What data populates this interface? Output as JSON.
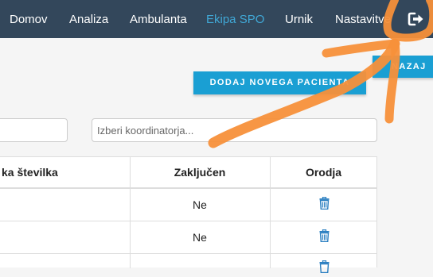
{
  "nav": {
    "items": [
      "Domov",
      "Analiza",
      "Ambulanta",
      "Ekipa SPO",
      "Urnik",
      "Nastavitve"
    ],
    "active_index": 3,
    "logout_icon": "sign-out-icon"
  },
  "actions": {
    "add_patient_label": "DODAJ NOVEGA PACIENTA",
    "back_label": "NAZAJ"
  },
  "filters": {
    "search_value": "",
    "coordinator_placeholder": "Izberi koordinatorja..."
  },
  "table": {
    "columns": [
      "ka številka",
      "Zaključen",
      "Orodja"
    ],
    "rows": [
      {
        "number": "",
        "closed": "Ne",
        "tool_icon": "trash-icon"
      },
      {
        "number": "",
        "closed": "Ne",
        "tool_icon": "trash-icon"
      },
      {
        "number": "",
        "closed": "",
        "tool_icon": "trash-icon"
      }
    ]
  },
  "colors": {
    "navbar": "#33475b",
    "active_nav": "#40a8d6",
    "primary": "#1a9fd3",
    "annotation": "#f7903a"
  }
}
